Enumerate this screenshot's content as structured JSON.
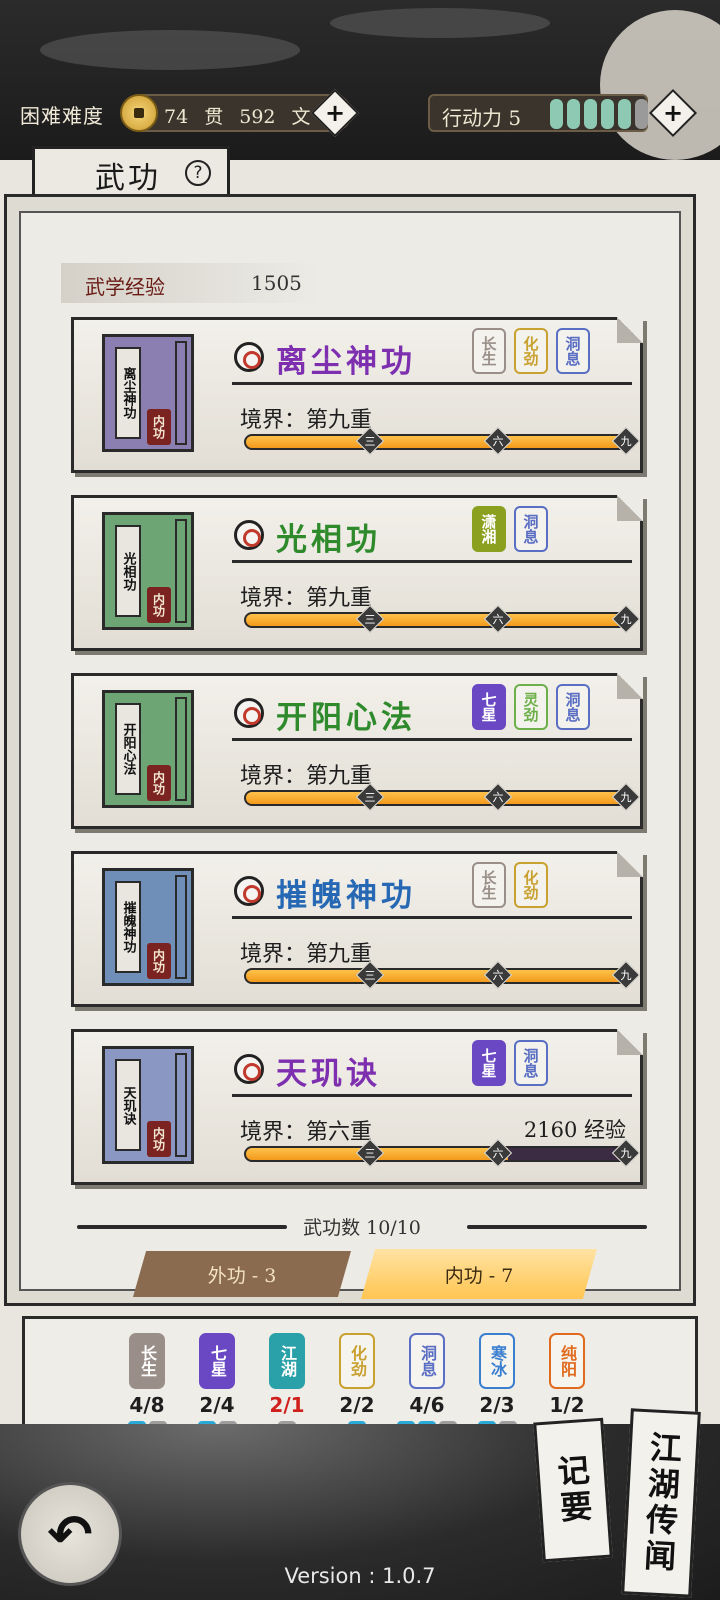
{
  "header": {
    "difficulty": "困难难度",
    "currency": "74 贯 592 文",
    "action_points_label": "行动力 5",
    "action_points": {
      "filled": 5,
      "total": 6
    },
    "plus_symbol": "+"
  },
  "tab": {
    "title": "武功",
    "help": "?"
  },
  "exp": {
    "label": "武学经验",
    "value": "1505"
  },
  "skills": [
    {
      "name": "离尘神功",
      "color": "#7d2fb0",
      "book_color": "#8a7fb0",
      "book_title": "离尘神功",
      "book_seal": "内功",
      "tags": [
        {
          "text": "长生",
          "color": "#9a8f88",
          "solid": false
        },
        {
          "text": "化劲",
          "color": "#c8a130",
          "solid": false
        },
        {
          "text": "洞息",
          "color": "#5a6fc4",
          "solid": false
        }
      ],
      "realm": "境界：第九重",
      "exp_need": "",
      "progress": 1.0,
      "markers": [
        "三",
        "六",
        "九"
      ]
    },
    {
      "name": "光相功",
      "color": "#2f8a2c",
      "book_color": "#6ea575",
      "book_title": "光相功",
      "book_seal": "内功",
      "tags": [
        {
          "text": "潇湘",
          "color": "#8aa01e",
          "solid": true
        },
        {
          "text": "洞息",
          "color": "#5a6fc4",
          "solid": false
        }
      ],
      "realm": "境界：第九重",
      "exp_need": "",
      "progress": 1.0,
      "markers": [
        "三",
        "六",
        "九"
      ]
    },
    {
      "name": "开阳心法",
      "color": "#2f8a2c",
      "book_color": "#6ea575",
      "book_title": "开阳心法",
      "book_seal": "内功",
      "tags": [
        {
          "text": "七星",
          "color": "#6a48c4",
          "solid": true
        },
        {
          "text": "灵劲",
          "color": "#6db04a",
          "solid": false
        },
        {
          "text": "洞息",
          "color": "#5a6fc4",
          "solid": false
        }
      ],
      "realm": "境界：第九重",
      "exp_need": "",
      "progress": 1.0,
      "markers": [
        "三",
        "六",
        "九"
      ]
    },
    {
      "name": "摧魄神功",
      "color": "#2668b4",
      "book_color": "#6f8fb8",
      "book_title": "摧魄神功",
      "book_seal": "内功",
      "tags": [
        {
          "text": "长生",
          "color": "#9a8f88",
          "solid": false
        },
        {
          "text": "化劲",
          "color": "#c8a130",
          "solid": false
        }
      ],
      "realm": "境界：第九重",
      "exp_need": "",
      "progress": 1.0,
      "markers": [
        "三",
        "六",
        "九"
      ]
    },
    {
      "name": "天玑诀",
      "color": "#7d2fb0",
      "book_color": "#8a97c2",
      "book_title": "天玑诀",
      "book_seal": "内功",
      "tags": [
        {
          "text": "七星",
          "color": "#6a48c4",
          "solid": true
        },
        {
          "text": "洞息",
          "color": "#5a6fc4",
          "solid": false
        }
      ],
      "realm": "境界：第六重",
      "exp_need": "2160 经验",
      "progress": 0.68,
      "markers": [
        "三",
        "六",
        "九"
      ]
    }
  ],
  "skill_count": "武功数 10/10",
  "tabs": {
    "outer": "外功 - 3",
    "inner": "内功 - 7"
  },
  "attributes": [
    {
      "name": "长生",
      "value": "4/8",
      "color": "#9a8f88",
      "solid": true,
      "red": false,
      "dots": [
        true,
        false
      ]
    },
    {
      "name": "七星",
      "value": "2/4",
      "color": "#6a48c4",
      "solid": true,
      "red": false,
      "dots": [
        true,
        false
      ]
    },
    {
      "name": "江湖",
      "value": "2/1",
      "color": "#2aa0a8",
      "solid": true,
      "red": true,
      "dots": [
        false
      ]
    },
    {
      "name": "化劲",
      "value": "2/2",
      "color": "#c8a130",
      "solid": false,
      "red": false,
      "dots": [
        true
      ]
    },
    {
      "name": "洞息",
      "value": "4/6",
      "color": "#5a6fc4",
      "solid": false,
      "red": false,
      "dots": [
        true,
        true,
        false
      ]
    },
    {
      "name": "寒冰",
      "value": "2/3",
      "color": "#3b7fd0",
      "solid": false,
      "red": false,
      "dots": [
        true,
        false
      ]
    },
    {
      "name": "纯阳",
      "value": "1/2",
      "color": "#e06a1e",
      "solid": false,
      "red": false,
      "dots": [
        false
      ]
    }
  ],
  "bottom": {
    "back_icon": "back-arrow-icon",
    "notes_label": "记要",
    "rumors_label": "江湖传闻",
    "version": "Version : 1.0.7"
  }
}
